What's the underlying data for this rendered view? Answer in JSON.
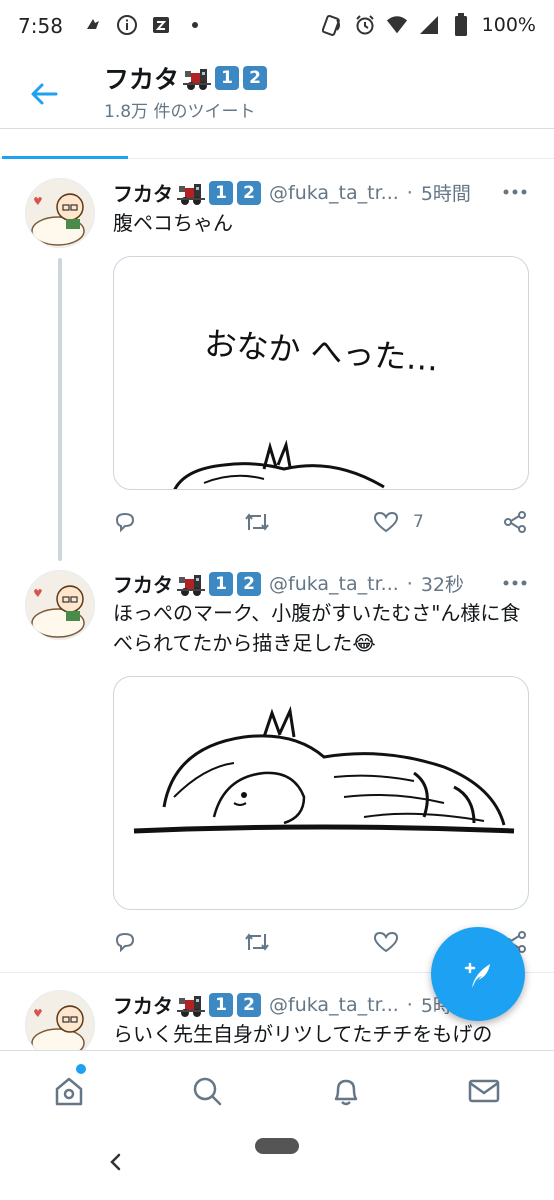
{
  "status_bar": {
    "time": "7:58",
    "battery": "100%",
    "icons_left": [
      "nfc-tap-icon",
      "info-icon",
      "app-notification-icon",
      "dot-icon"
    ],
    "icons_right": [
      "nfc-icon",
      "alarm-icon",
      "wifi-icon",
      "signal-icon",
      "battery-icon"
    ]
  },
  "header": {
    "title": "フカタ",
    "badges": [
      "1",
      "2"
    ],
    "tweet_count": "1.8万 件のツイート"
  },
  "colors": {
    "accent": "#1da1f2",
    "text": "#14171a",
    "secondary": "#657786",
    "badge": "#3b88c3"
  },
  "tweets": [
    {
      "name": "フカタ",
      "badges": [
        "1",
        "2"
      ],
      "handle": "@fuka_ta_tr...",
      "separator": "·",
      "age": "5時間",
      "text": "腹ペコちゃん",
      "image_text": "おなか へった…",
      "likes": "7"
    },
    {
      "name": "フカタ",
      "badges": [
        "1",
        "2"
      ],
      "handle": "@fuka_ta_tr...",
      "separator": "·",
      "age": "32秒",
      "text": "ほっぺのマーク、小腹がすいたむさ\"ん様に食べられてたから描き足した😂",
      "likes": ""
    },
    {
      "name": "フカタ",
      "badges": [
        "1",
        "2"
      ],
      "handle": "@fuka_ta_tr...",
      "separator": "·",
      "age": "5時",
      "text": "らいく先生自身がリツしてたチチをもげの"
    }
  ],
  "bottom_nav": [
    "home-icon",
    "search-icon",
    "notifications-icon",
    "messages-icon"
  ]
}
